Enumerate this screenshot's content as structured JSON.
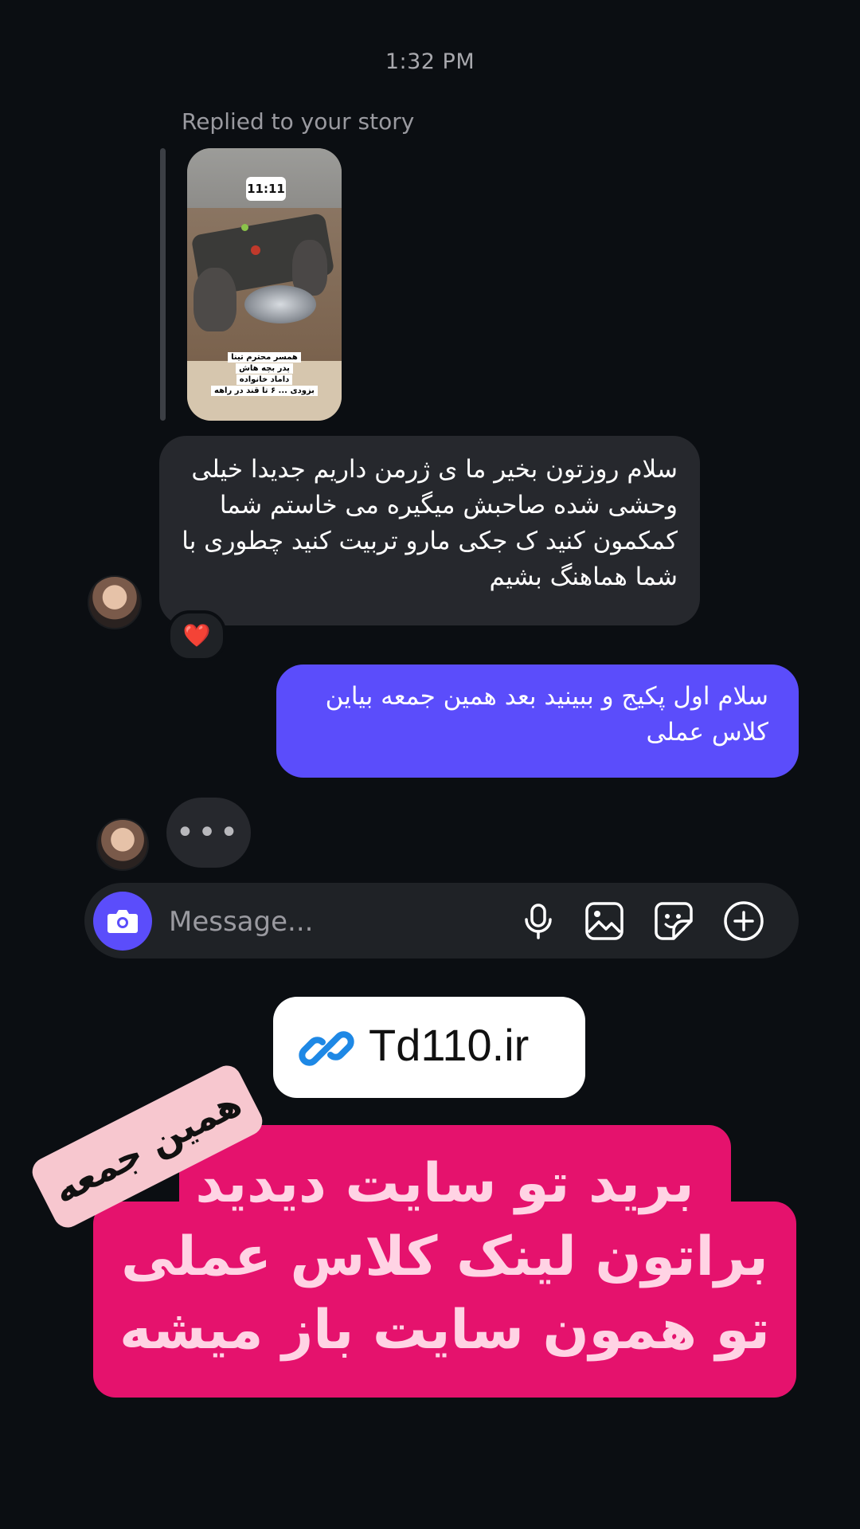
{
  "header": {
    "timestamp": "1:32 PM"
  },
  "story_reply": {
    "label": "Replied to your story",
    "story_clock": "11:11",
    "story_caption_lines": [
      "همسر محترم تینا",
      "پدر بچه هاش",
      "داماد خانواده",
      "بزودی ... ۶ تا قند در راهه"
    ]
  },
  "messages": {
    "incoming_text": "سلام روزتون بخیر ما ی ژرمن داریم جدیدا خیلی وحشی شده صاحبش میگیره  می خاستم شما کمکمون کنید ک جکی مارو تربیت کنید چطوری با شما هماهنگ بشیم",
    "incoming_reaction": "❤️",
    "outgoing_text": "سلام اول پکیج و ببینید بعد همین جمعه بیاین کلاس عملی",
    "typing_indicator": "•••"
  },
  "composer": {
    "placeholder": "Message...",
    "icons": [
      "camera-icon",
      "microphone-icon",
      "gallery-icon",
      "sticker-icon",
      "plus-circle-icon"
    ]
  },
  "overlay": {
    "link_text": "Td110.ir",
    "link_icon": "link-icon",
    "sticker_text": "همین جمعه",
    "pink_lines": [
      "برید تو سایت دیدید",
      "براتون لینک کلاس عملی",
      "تو همون سایت باز میشه"
    ]
  },
  "colors": {
    "background": "#0b0e12",
    "incoming_bubble": "#26282d",
    "outgoing_bubble": "#5b4dfb",
    "highlight": "#e5126d",
    "link_icon": "#1e88e5"
  }
}
